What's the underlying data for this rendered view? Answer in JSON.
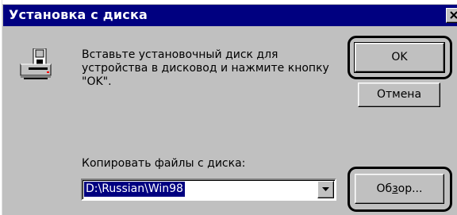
{
  "window": {
    "title": "Установка с диска",
    "close_glyph": "✕"
  },
  "message": {
    "text": "Вставьте установочный диск для\nустройства в дисковод и нажмите кнопку\n\"OK\"."
  },
  "copy_from": {
    "label": "Копировать файлы с диска:",
    "value": "D:\\Russian\\Win98"
  },
  "buttons": {
    "ok_label": "OK",
    "cancel_label": "Отмена",
    "browse_label_pre": "Об",
    "browse_label_accel": "з",
    "browse_label_post": "ор..."
  },
  "icons": {
    "disk": "disk-drive-icon",
    "dropdown": "chevron-down-icon",
    "close": "close-icon"
  },
  "colors": {
    "dialog_bg": "#c0c0c0",
    "titlebar_bg": "#000080",
    "selection_bg": "#000080"
  }
}
